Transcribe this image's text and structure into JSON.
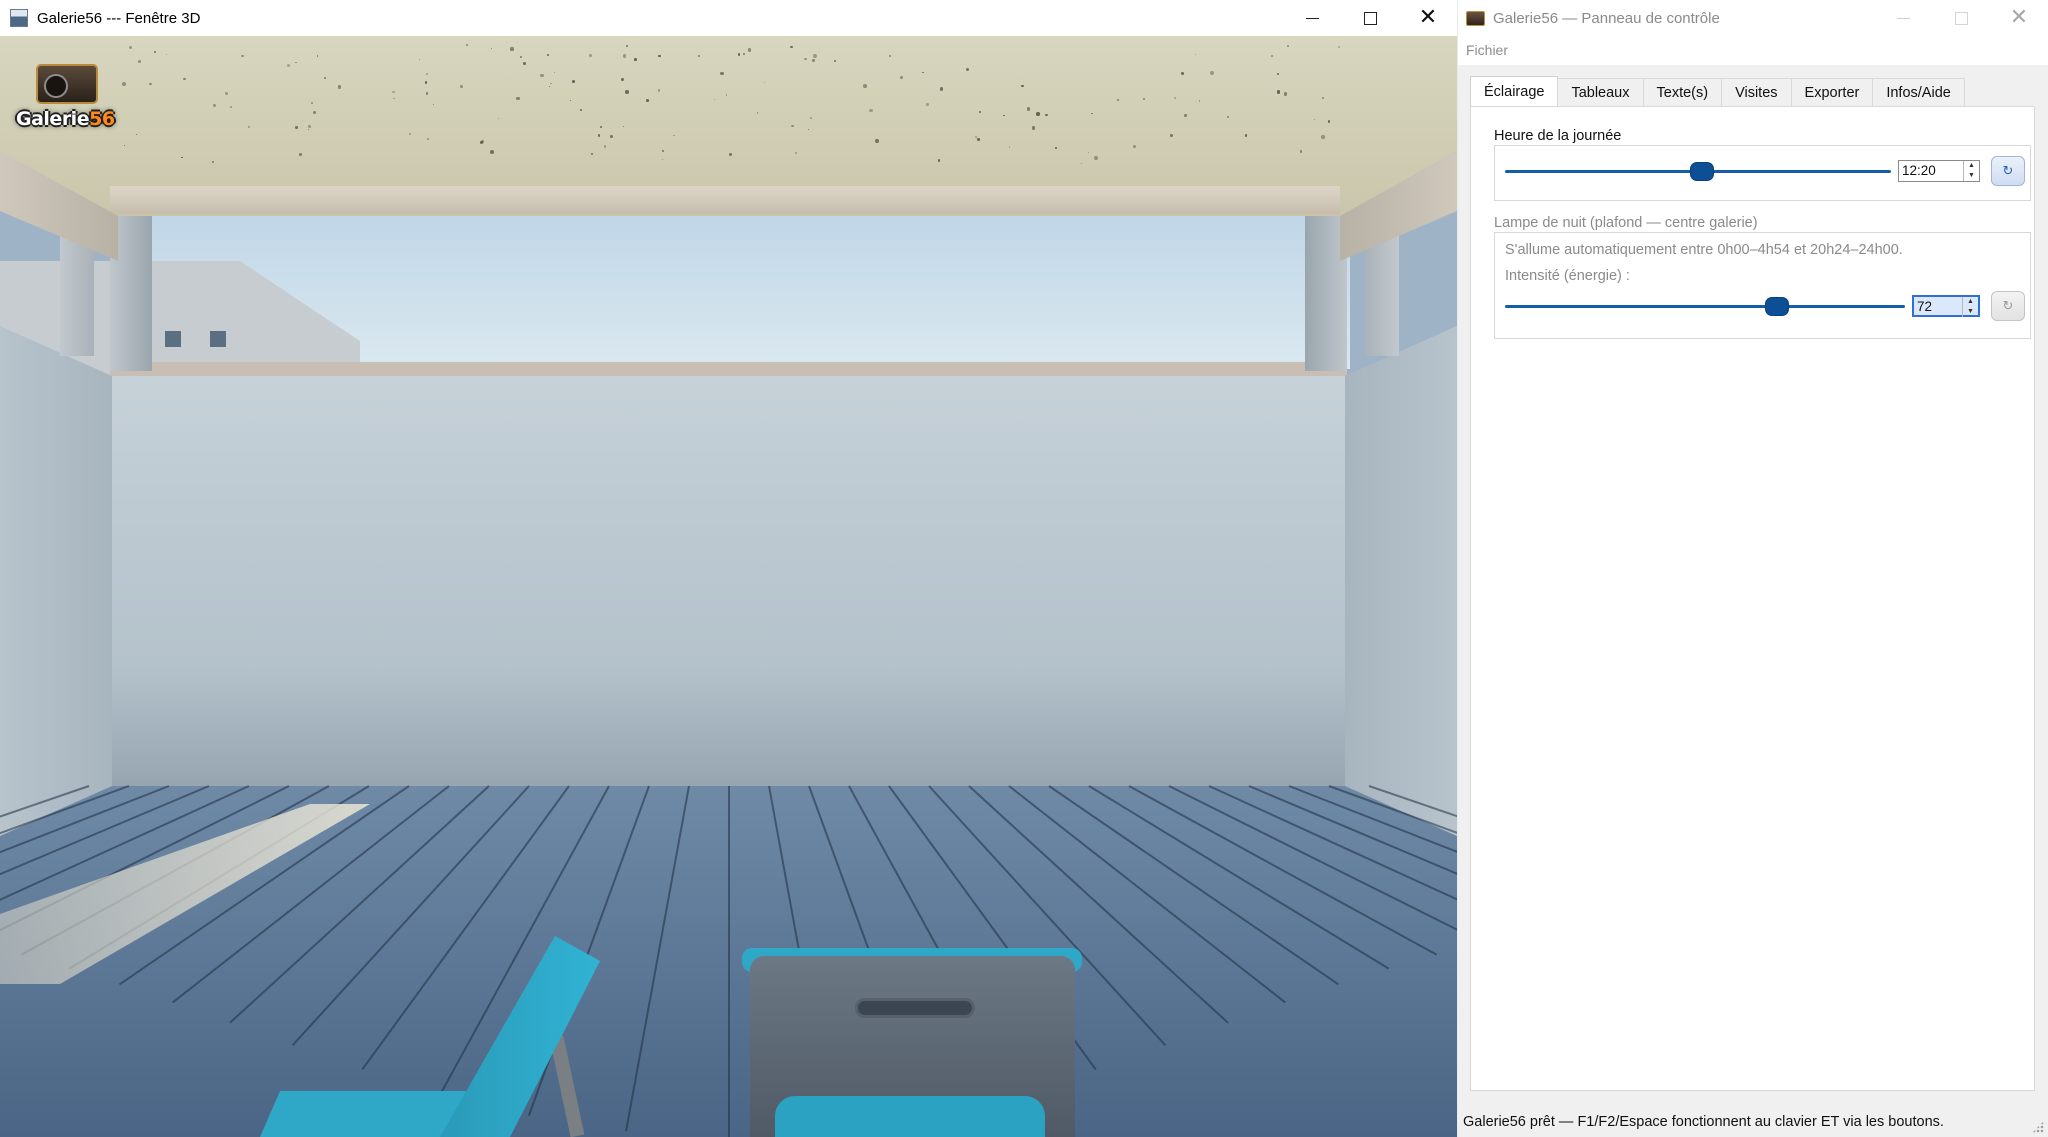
{
  "window3d": {
    "title": "Galerie56 --- Fenêtre 3D",
    "logo_text_main": "Galerie",
    "logo_text_num": "56"
  },
  "panel": {
    "title": "Galerie56 — Panneau de contrôle",
    "menu": [
      "Fichier"
    ],
    "tabs": [
      {
        "label": "Éclairage",
        "active": true
      },
      {
        "label": "Tableaux",
        "active": false
      },
      {
        "label": "Texte(s)",
        "active": false
      },
      {
        "label": "Visites",
        "active": false
      },
      {
        "label": "Exporter",
        "active": false
      },
      {
        "label": "Infos/Aide",
        "active": false
      }
    ],
    "time_of_day": {
      "group_title": "Heure de la journée",
      "slider_fraction": 0.51,
      "value": "12:20"
    },
    "night_lamp": {
      "group_title": "Lampe de nuit (plafond — centre galerie)",
      "note": "S'allume automatiquement entre 0h00–4h54 et 20h24–24h00.",
      "intensity_label": "Intensité (énergie) :",
      "slider_fraction": 0.68,
      "value": "72"
    },
    "status": "Galerie56 prêt — F1/F2/Espace fonctionnent au clavier ET via les boutons."
  },
  "icons": {
    "minimize": "minimize-icon",
    "maximize": "maximize-icon",
    "close": "close-icon",
    "reset": "reset-icon",
    "spin_up": "spin-up-icon",
    "spin_down": "spin-down-icon"
  },
  "colors": {
    "slider_accent": "#0d4f94",
    "focus_border": "#2e6fd8"
  }
}
